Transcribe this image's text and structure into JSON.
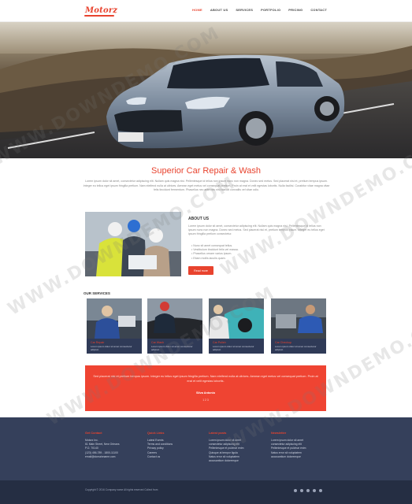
{
  "header": {
    "logo": "Motorz",
    "nav": [
      "HOME",
      "ABOUT US",
      "SERVICES",
      "PORTFOLIO",
      "PRICING",
      "CONTACT"
    ]
  },
  "main": {
    "title": "Superior Car Repair & Wash",
    "intro": "Lorem ipsum dolor sit amet, consectetur adipiscing elit. Nullam quis magna nisi. Pellentesque id tellus non ipsum nunc non magna. Donec sed metus. Sed placerat nisi et, pretium tempus ipsum. Integer eu tellus eget ipsum fringilla pretium. Nam eleifend nulla at ultrices. Aenean eget metus vel consequat pretium. Proin at erat et velit egestas lobortis. Nulla facilisi. Curabitur vitae magna vitae felis tincidunt fermentum. Phasellus nec ante nec nisi blandit convallis vel vitae odio.",
    "about": {
      "title": "ABOUT US",
      "text": "Lorem ipsum dolor sit amet, consectetur adipiscing elit. Nullam quis magna nisi. Pellentesque id tellus non ipsum nunc non magna. Donec sed metus. Sed placerat nisi et, pretium tempus ipsum. Integer eu tellus eget ipsum fringilla pretium consectetur.",
      "list": [
        "Nunc sit amet consequat tellus.",
        "Vestibulum tincidunt felis vel massa.",
        "Phasellus ornare varius ipsum.",
        "Etiam mollis iaculis quam."
      ],
      "button": "Read more"
    },
    "services_title": "OUR SERVICES",
    "services": [
      {
        "name": "Car Repair",
        "desc": "Lorem ipsum dolor sit amet consectetur adipisci."
      },
      {
        "name": "Car Wash",
        "desc": "Lorem ipsum dolor sit amet consectetur adipisci."
      },
      {
        "name": "Car Polish",
        "desc": "Lorem ipsum dolor sit amet consectetur adipisci."
      },
      {
        "name": "Car Checkup",
        "desc": "Lorem ipsum dolor sit amet consectetur adipisci."
      }
    ],
    "testimonial": {
      "quote": "Sed placerat nisi et pretium tempus ipsum. Integer eu tellus eget ipsum fringilla pretium. Nam eleifend nulla at ultrices. Aenean eget metus vel consequat pretium. Proin at erat et velit egestas lobortis.",
      "author": "Silva Antonio",
      "page": "1 2 3"
    }
  },
  "footer": {
    "col1": {
      "title": "Get Contact",
      "lines": [
        "Motorz Inc.",
        "61 Main Street, New Orleans",
        "P.O. 70140",
        "(123) 456-789 - 1800-11100",
        "email@domainname.com"
      ]
    },
    "col2": {
      "title": "Quick Links",
      "lines": [
        "Latest Events",
        "Terms and conditions",
        "Privacy policy",
        "Careers",
        "Contact us"
      ]
    },
    "col3": {
      "title": "Latest posts",
      "lines": [
        "Lorem ipsum dolor sit amet",
        "consectetur adipiscing elit",
        "Pellentesque et pulvinar enim",
        "Quisque at tempor ligula",
        "Natus error sit voluptatem",
        "accusantium doloremque"
      ]
    },
    "col4": {
      "title": "Newsletter",
      "lines": [
        "Lorem ipsum dolor sit amet",
        "consectetur adipiscing elit",
        "Pellentesque et pulvinar enim",
        "Natus error sit voluptatem",
        "accusantium doloremque"
      ]
    },
    "copyright": "Copyright © 2016 Company name All rights reserved",
    "credit": "Collect from"
  },
  "colors": {
    "accent": "#e8432e",
    "footer": "#35405b",
    "footer_bottom": "#252e43"
  },
  "watermark": "WWW.DOWNDEMO.COM"
}
